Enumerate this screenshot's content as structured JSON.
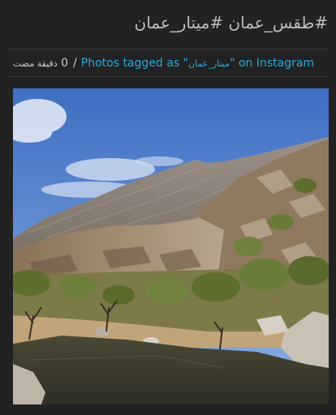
{
  "post": {
    "title": "#طقس_عمان #ميتار_عمان",
    "time_count": "0",
    "time_unit": "دقيقة مضت",
    "separator": "/",
    "link_prefix": "Photos tagged as \"",
    "link_tag": "ميتار_عمان",
    "link_suffix": "\" on Instagram"
  },
  "photo": {
    "subject": "mountain-valley-with-pond-landscape",
    "colors": {
      "sky_top": "#3f6fc4",
      "sky_bottom": "#8fb0e0",
      "mountain": "#8c8279",
      "rock": "#a08a6e",
      "vegetation": "#6d7f3a",
      "water": "#3e3d2e"
    }
  }
}
